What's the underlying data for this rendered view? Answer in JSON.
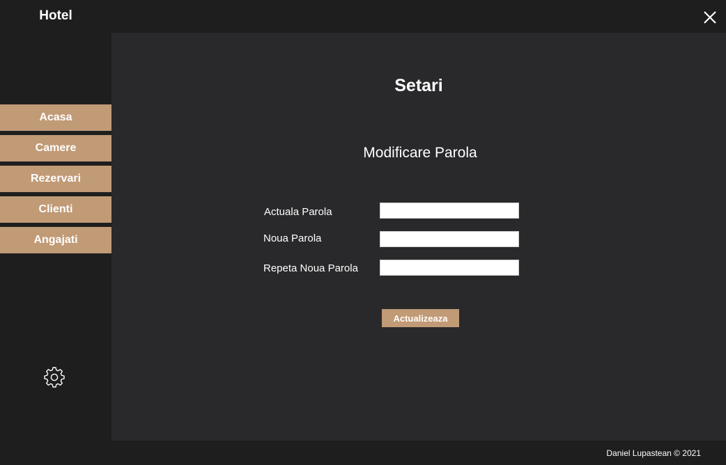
{
  "app": {
    "title": "Hotel"
  },
  "window": {
    "close_icon": "close-icon"
  },
  "sidebar": {
    "items": [
      {
        "label": "Acasa"
      },
      {
        "label": "Camere"
      },
      {
        "label": "Rezervari"
      },
      {
        "label": "Clienti"
      },
      {
        "label": "Angajati"
      }
    ],
    "settings_icon": "gear-icon"
  },
  "main": {
    "title": "Setari",
    "section_title": "Modificare Parola",
    "fields": [
      {
        "label": "Actuala Parola",
        "value": ""
      },
      {
        "label": "Noua Parola",
        "value": ""
      },
      {
        "label": "Repeta Noua Parola",
        "value": ""
      }
    ],
    "update_button": "Actualizeaza"
  },
  "footer": {
    "text": "Daniel Lupastean © 2021"
  },
  "colors": {
    "accent": "#c19a76",
    "sidebar_bg": "#1e1e1e",
    "content_bg": "#29292b"
  }
}
